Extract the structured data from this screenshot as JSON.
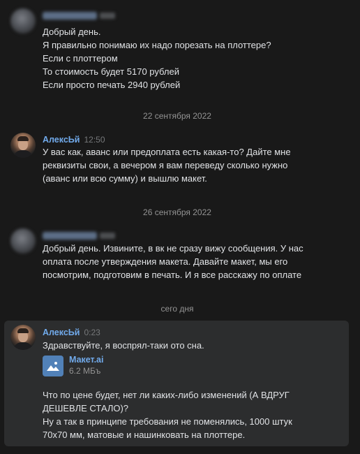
{
  "date_separators": [
    "22 сентября 2022",
    "26 сентября 2022",
    "сего дня"
  ],
  "messages": [
    {
      "author": "",
      "time": "",
      "lines": [
        "Добрый день.",
        "Я правильно понимаю их надо порезать на плоттере?",
        "Если с плоттером",
        "То стоимость будет 5170 рублей",
        "Если просто печать 2940 рублей"
      ]
    },
    {
      "author": "АлексЬй",
      "time": "12:50",
      "lines": [
        "У вас как, аванс или предоплата есть какая-то? Дайте мне",
        "реквизиты свои, а вечером я вам переведу сколько нужно",
        "(аванс или всю сумму) и вышлю макет."
      ]
    },
    {
      "author": "",
      "time": "",
      "lines": [
        "Добрый день. Извините, в вк не сразу вижу сообщения. У нас",
        "оплата после утверждения макета. Давайте макет, мы его",
        "посмотрим, подготовим в печать. И я все расскажу по оплате"
      ]
    },
    {
      "author": "АлексЬй",
      "time": "0:23",
      "lines": [
        "Здравствуйте, я воспрял-таки ото сна."
      ],
      "attachment": {
        "name": "Макет.ai",
        "size": "6.2 МБъ",
        "icon": "image-file-icon"
      },
      "lines_after": [
        "Что по цене будет, нет ли каких-либо изменений (А ВДРУГ",
        "ДЕШЕВЛЕ СТАЛО)?",
        "Ну а так в принципе требования не поменялись, 1000 штук",
        "70x70 мм, матовые и нашинковать на плоттере."
      ]
    }
  ],
  "colors": {
    "background": "#191919",
    "highlight": "#2c2d2e",
    "author": "#71aaeb",
    "text": "#e1e3e6",
    "meta": "#939393",
    "file_icon": "#5181b8"
  }
}
